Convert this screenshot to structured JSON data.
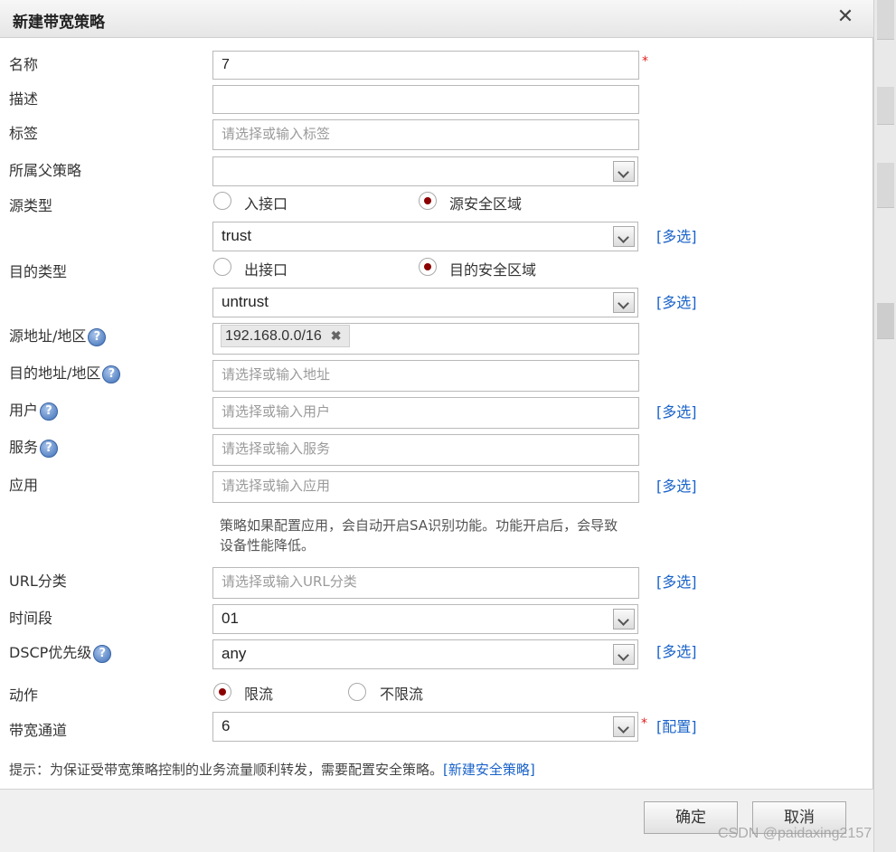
{
  "dialog": {
    "title": "新建带宽策略",
    "close_glyph": "✕"
  },
  "form": {
    "name": {
      "label": "名称",
      "value": "7",
      "required": "*"
    },
    "description": {
      "label": "描述",
      "value": ""
    },
    "tags": {
      "label": "标签",
      "placeholder": "请选择或输入标签"
    },
    "parent_policy": {
      "label": "所属父策略",
      "value": ""
    },
    "source_type": {
      "label": "源类型",
      "options": [
        "入接口",
        "源安全区域"
      ],
      "selected": "源安全区域",
      "zone_value": "trust",
      "multi_link": "[多选]"
    },
    "dest_type": {
      "label": "目的类型",
      "options": [
        "出接口",
        "目的安全区域"
      ],
      "selected": "目的安全区域",
      "zone_value": "untrust",
      "multi_link": "[多选]"
    },
    "source_address": {
      "label": "源地址/地区",
      "help": "?",
      "tag": "192.168.0.0/16",
      "tag_remove": "✖"
    },
    "dest_address": {
      "label": "目的地址/地区",
      "help": "?",
      "placeholder": "请选择或输入地址"
    },
    "user": {
      "label": "用户",
      "help": "?",
      "placeholder": "请选择或输入用户",
      "multi_link": "[多选]"
    },
    "service": {
      "label": "服务",
      "help": "?",
      "placeholder": "请选择或输入服务"
    },
    "application": {
      "label": "应用",
      "placeholder": "请选择或输入应用",
      "multi_link": "[多选]",
      "note": "策略如果配置应用，会自动开启SA识别功能。功能开启后，会导致设备性能降低。"
    },
    "url_category": {
      "label": "URL分类",
      "placeholder": "请选择或输入URL分类",
      "multi_link": "[多选]"
    },
    "time_range": {
      "label": "时间段",
      "value": "01"
    },
    "dscp": {
      "label": "DSCP优先级",
      "help": "?",
      "value": "any",
      "multi_link": "[多选]"
    },
    "action": {
      "label": "动作",
      "options": [
        "限流",
        "不限流"
      ],
      "selected": "限流"
    },
    "bandwidth_channel": {
      "label": "带宽通道",
      "value": "6",
      "required": "*",
      "config_link": "[配置]"
    }
  },
  "tip": {
    "text": "提示：为保证受带宽策略控制的业务流量顺利转发，需要配置安全策略。",
    "link": "[新建安全策略]"
  },
  "buttons": {
    "ok": "确定",
    "cancel": "取消"
  },
  "watermark": "CSDN @paidaxing2157",
  "colors": {
    "accent_link": "#1a63c9",
    "required": "#e02020",
    "radio_dot": "#8b0000"
  }
}
